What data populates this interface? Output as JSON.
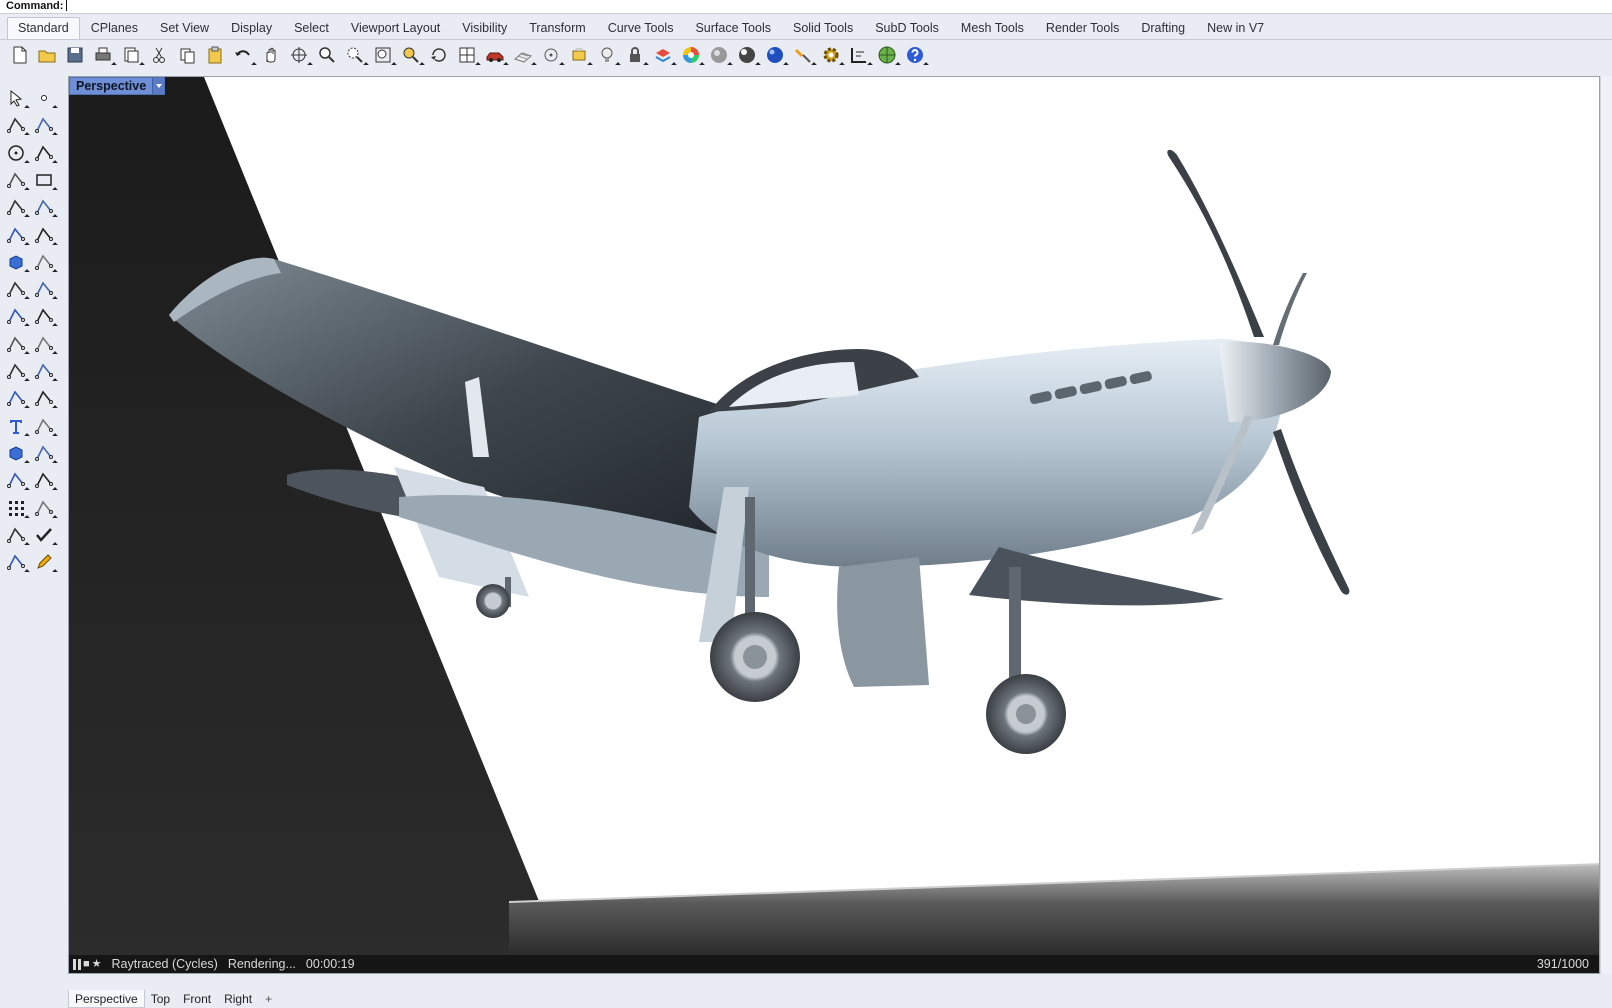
{
  "command": {
    "label": "Command:",
    "value": ""
  },
  "tabs": [
    {
      "label": "Standard",
      "active": true
    },
    {
      "label": "CPlanes"
    },
    {
      "label": "Set View"
    },
    {
      "label": "Display"
    },
    {
      "label": "Select"
    },
    {
      "label": "Viewport Layout"
    },
    {
      "label": "Visibility"
    },
    {
      "label": "Transform"
    },
    {
      "label": "Curve Tools"
    },
    {
      "label": "Surface Tools"
    },
    {
      "label": "Solid Tools"
    },
    {
      "label": "SubD Tools"
    },
    {
      "label": "Mesh Tools"
    },
    {
      "label": "Render Tools"
    },
    {
      "label": "Drafting"
    },
    {
      "label": "New in V7"
    }
  ],
  "toolbar_icons": [
    "new-file-icon",
    "open-folder-icon",
    "save-icon",
    "print-icon",
    "import-icon",
    "cut-icon",
    "copy-icon",
    "paste-icon",
    "undo-icon",
    "pan-hand-icon",
    "rotate-view-icon",
    "zoom-icon",
    "zoom-window-icon",
    "zoom-extents-icon",
    "zoom-selected-icon",
    "rotate-camera-icon",
    "four-viewports-icon",
    "car-object-icon",
    "grid-plane-icon",
    "point-snap-icon",
    "named-view-icon",
    "light-bulb-icon",
    "lock-icon",
    "layer-icon",
    "color-wheel-icon",
    "shaded-sphere-icon",
    "rendered-sphere-icon",
    "blue-sphere-icon",
    "flashlight-icon",
    "settings-gear-icon",
    "dimension-icon",
    "globe-icon",
    "help-icon"
  ],
  "left_toolbar_icons": [
    "select-arrow-icon",
    "point-icon",
    "polyline-icon",
    "curve-point-icon",
    "circle-icon",
    "ellipse-icon",
    "polygon-icon",
    "rectangle-icon",
    "arc-icon",
    "fillet-curve-icon",
    "surface-icon",
    "revolve-icon",
    "box-solid-icon",
    "boolean-icon",
    "extrude-icon",
    "mesh-icon",
    "transform-icon",
    "array-icon",
    "split-icon",
    "trim-icon",
    "group-icon",
    "explode-icon",
    "offset-icon",
    "blend-curve-icon",
    "text-icon",
    "dimension-line-icon",
    "block-icon",
    "measure-icon",
    "box-edit-icon",
    "wire-icon",
    "grid-array-icon",
    "section-icon",
    "properties-icon",
    "check-icon",
    "solid-edit-icon",
    "pencil-icon"
  ],
  "viewport": {
    "title": "Perspective"
  },
  "render_status": {
    "mode": "Raytraced (Cycles)",
    "state": "Rendering...",
    "time": "00:00:19",
    "progress": "391/1000"
  },
  "view_tabs": [
    {
      "label": "Perspective",
      "active": true
    },
    {
      "label": "Top"
    },
    {
      "label": "Front"
    },
    {
      "label": "Right"
    }
  ],
  "add_view_symbol": "+"
}
